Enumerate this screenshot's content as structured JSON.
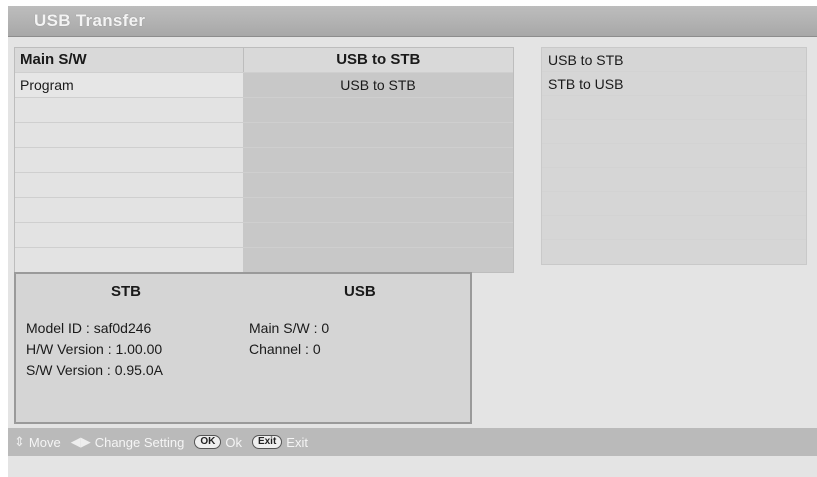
{
  "window": {
    "title": "USB Transfer"
  },
  "table": {
    "header": {
      "label": "Main S/W",
      "value": "USB to STB"
    },
    "rows": [
      {
        "label": "Program",
        "value": "USB to STB"
      }
    ]
  },
  "options": [
    "USB to STB",
    "STB to USB"
  ],
  "info": {
    "stb_title": "STB",
    "usb_title": "USB",
    "model_id": "Model ID : saf0d246",
    "hw_version": "H/W Version : 1.00.00",
    "sw_version": "S/W Version : 0.95.0A",
    "usb_main_sw": "Main S/W : 0",
    "usb_channel": "Channel : 0"
  },
  "help": {
    "move": "Move",
    "change_setting": "Change Setting",
    "ok_key": "OK",
    "ok": "Ok",
    "exit_key": "Exit",
    "exit": "Exit"
  }
}
